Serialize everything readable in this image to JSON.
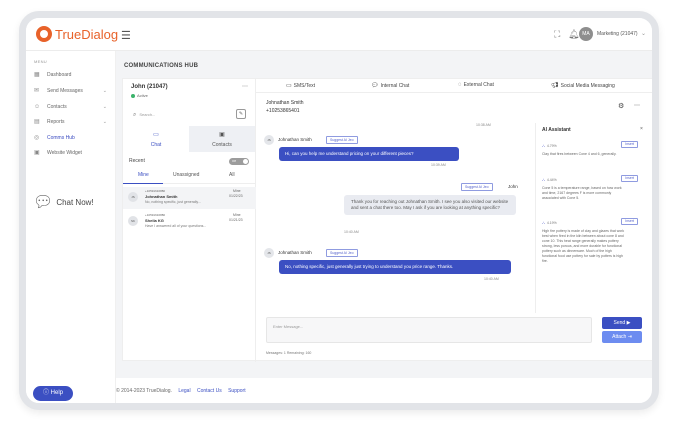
{
  "brand": {
    "name": "TrueDialog"
  },
  "topbar": {
    "user_initials": "MA",
    "user_name": "Marketing (21047)",
    "icons": [
      "expand-icon",
      "bell-icon"
    ]
  },
  "sidebar": {
    "caption": "MENU",
    "items": [
      {
        "label": "Dashboard",
        "icon": "dashboard-icon"
      },
      {
        "label": "Send Messages",
        "icon": "send-icon",
        "expandable": true
      },
      {
        "label": "Contacts",
        "icon": "contacts-icon",
        "expandable": true
      },
      {
        "label": "Reports",
        "icon": "reports-icon",
        "expandable": true
      },
      {
        "label": "Comms Hub",
        "icon": "hub-icon",
        "active": true
      },
      {
        "label": "Website Widget",
        "icon": "widget-icon"
      }
    ],
    "chat_now": "Chat Now!",
    "help": "Help"
  },
  "page": {
    "title": "COMMUNICATIONS HUB"
  },
  "contact": {
    "name": "John (21047)",
    "status": "Active"
  },
  "search": {
    "placeholder": "Search..."
  },
  "contact_tabs": {
    "chat": "Chat",
    "contacts": "Contacts"
  },
  "recent": {
    "label": "Recent",
    "toggle": "Off"
  },
  "filters": {
    "mine": "Mine",
    "unassigned": "Unassigned",
    "all": "All"
  },
  "conversations": [
    {
      "initials": "JS",
      "phone": "+10591616880",
      "name": "Johnathan Smith",
      "snippet": "No, nothing specific, just generally...",
      "owner": "Mine",
      "date": "01/22/23"
    },
    {
      "initials": "SK",
      "phone": "+10591616880",
      "name": "Sheila KG",
      "snippet": "Have I answered all of your questions...",
      "owner": "Mine",
      "date": "01/21/23"
    }
  ],
  "channel_tabs": [
    {
      "label": "SMS/Text",
      "icon": "sms-icon"
    },
    {
      "label": "Internal Chat",
      "icon": "internal-chat-icon"
    },
    {
      "label": "External Chat",
      "icon": "external-chat-icon"
    },
    {
      "label": "Social Media Messaging",
      "icon": "megaphone-icon"
    }
  ],
  "conversation_header": {
    "name": "Johnathan Smith",
    "phone": "+10253865401"
  },
  "messages": {
    "ts1": "10:38 AM",
    "msg1": {
      "sender": "Johnathan Smith",
      "initials": "JS",
      "chip": "Suggest AI Jeo",
      "text": "Hi, can you help me understand pricing on your different pieces?",
      "time": "10:39 AM"
    },
    "msg2": {
      "chip": "Suggest AI Jeo",
      "sender": "John",
      "text": "Thank you for reaching out Johnathan Smith. I see you also visited our website and sent a chat there too. May I ask if you are looking at anything specific?",
      "time": "10:40 AM"
    },
    "msg3": {
      "sender": "Johnathan Smith",
      "initials": "JS",
      "chip": "Suggest AI Jeo",
      "text": "No, nothing specific, just generally just trying to understand you price range. Thanks.",
      "time": "10:40 AM"
    }
  },
  "composer": {
    "placeholder": "Enter Message...",
    "send": "Send",
    "attach": "Attach",
    "count": "Messages: 1 Remaining: 160"
  },
  "ai_assistant": {
    "title": "AI Assistant",
    "insert": "Insert",
    "cards": [
      {
        "score": "4.79%",
        "text": "Clay that fires between Cone 4 and 6, generally."
      },
      {
        "score": "4.44%",
        "text": "Cone 5 is a temperature range, based on how work and time, 2167 degrees F is more commonly associated with Cone 5."
      },
      {
        "score": "4.19%",
        "text": "High fire pottery is made of clay and glazes that work best when fired in the kiln between about cone 8 and cone 10. This heat range generally makes pottery strong, less porous, and more durable for functional pottery such as dinnerware. Much of the high functional food use pottery for sale by potters is high fire."
      }
    ]
  },
  "footer": {
    "copyright": "© 2014-2023 TrueDialog.",
    "links": [
      "Legal",
      "Contact Us",
      "Support"
    ]
  }
}
